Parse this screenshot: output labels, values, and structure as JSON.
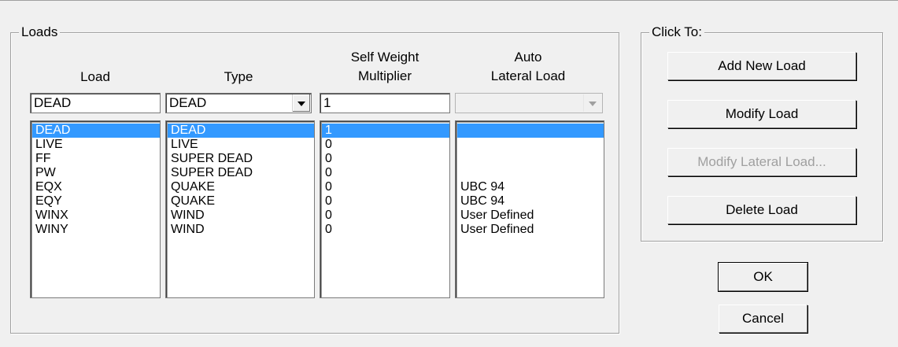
{
  "loads_group": {
    "title": "Loads",
    "headers": {
      "load": "Load",
      "type": "Type",
      "self_weight": "Self Weight\nMultiplier",
      "auto_lateral": "Auto\nLateral Load"
    },
    "inputs": {
      "load": "DEAD",
      "type": "DEAD",
      "self_weight": "1",
      "auto_lateral": ""
    },
    "rows": [
      {
        "load": "DEAD",
        "type": "DEAD",
        "multiplier": "1",
        "auto": ""
      },
      {
        "load": "LIVE",
        "type": "LIVE",
        "multiplier": "0",
        "auto": ""
      },
      {
        "load": "FF",
        "type": "SUPER DEAD",
        "multiplier": "0",
        "auto": ""
      },
      {
        "load": "PW",
        "type": "SUPER DEAD",
        "multiplier": "0",
        "auto": ""
      },
      {
        "load": "EQX",
        "type": "QUAKE",
        "multiplier": "0",
        "auto": "UBC 94"
      },
      {
        "load": "EQY",
        "type": "QUAKE",
        "multiplier": "0",
        "auto": "UBC 94"
      },
      {
        "load": "WINX",
        "type": "WIND",
        "multiplier": "0",
        "auto": "User Defined"
      },
      {
        "load": "WINY",
        "type": "WIND",
        "multiplier": "0",
        "auto": "User Defined"
      }
    ],
    "selected_index": 0
  },
  "click_group": {
    "title": "Click To:",
    "add_new_load": "Add New Load",
    "modify_load": "Modify Load",
    "modify_lateral_load": "Modify Lateral Load...",
    "delete_load": "Delete Load"
  },
  "ok_label": "OK",
  "cancel_label": "Cancel",
  "colors": {
    "selection": "#3399ff",
    "background": "#f0f0f0",
    "disabled_text": "#a0a0a0"
  },
  "icons": {
    "dropdown": "triangle-down"
  }
}
